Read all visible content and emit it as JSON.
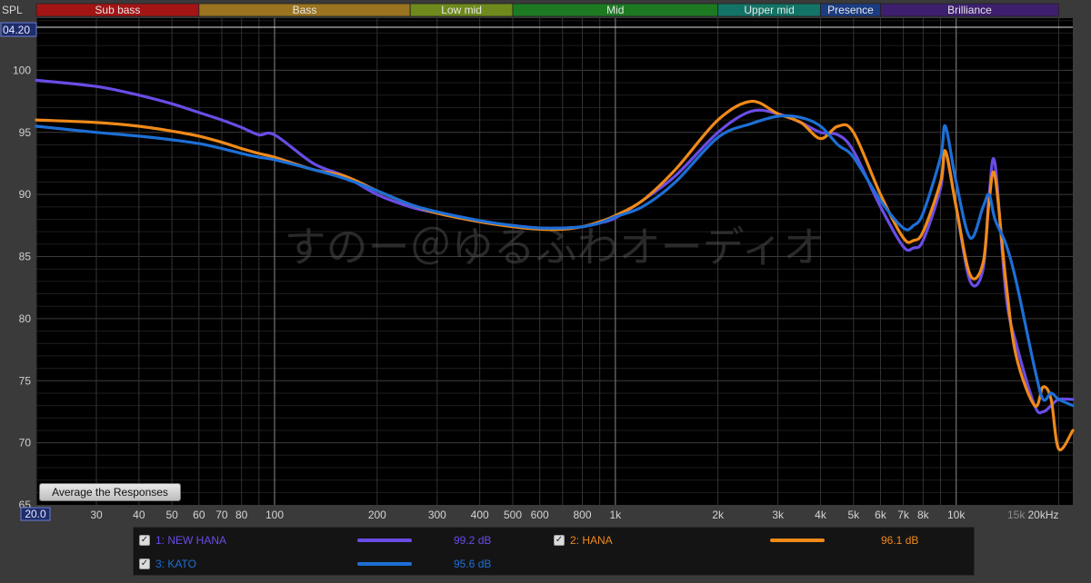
{
  "chart_data": {
    "type": "line",
    "ylabel": "SPL",
    "xlabel": "",
    "cursor_value": "04.20",
    "x_scale": "log",
    "xlim": [
      20,
      22000
    ],
    "ylim": [
      65,
      104.2
    ],
    "y_ticks": [
      65,
      70,
      75,
      80,
      85,
      90,
      95,
      100
    ],
    "y_tick_labels": [
      "65",
      "70",
      "75",
      "80",
      "85",
      "90",
      "95",
      "100"
    ],
    "x_ticks": [
      20,
      30,
      40,
      50,
      60,
      70,
      80,
      100,
      200,
      300,
      400,
      500,
      600,
      800,
      1000,
      2000,
      3000,
      4000,
      5000,
      6000,
      7000,
      8000,
      10000,
      15000,
      20000
    ],
    "x_tick_labels": [
      "20.0",
      "30",
      "40",
      "50",
      "60",
      "70",
      "80",
      "100",
      "200",
      "300",
      "400",
      "500",
      "600",
      "800",
      "1k",
      "2k",
      "3k",
      "4k",
      "5k",
      "6k",
      "7k",
      "8k",
      "10k",
      "15k",
      "20kHz"
    ],
    "grid": true,
    "bands": [
      {
        "label": "Sub bass",
        "from": 20,
        "to": 60,
        "color": "#a31414"
      },
      {
        "label": "Bass",
        "from": 60,
        "to": 250,
        "color": "#9a7420"
      },
      {
        "label": "Low mid",
        "from": 250,
        "to": 500,
        "color": "#6f8a1c"
      },
      {
        "label": "Mid",
        "from": 500,
        "to": 2000,
        "color": "#1d7a22"
      },
      {
        "label": "Upper mid",
        "from": 2000,
        "to": 4000,
        "color": "#137366"
      },
      {
        "label": "Presence",
        "from": 4000,
        "to": 6000,
        "color": "#1b3c82"
      },
      {
        "label": "Brilliance",
        "from": 6000,
        "to": 20000,
        "color": "#3d1f6e"
      }
    ],
    "watermark": "すのー＠ゆるふわオーディオ",
    "series": [
      {
        "name": "1: NEW HANA",
        "color": "#6a4ce6",
        "avg": "99.2 dB",
        "x": [
          20,
          30,
          40,
          50,
          60,
          70,
          80,
          90,
          100,
          130,
          160,
          200,
          250,
          300,
          400,
          500,
          600,
          700,
          800,
          900,
          1000,
          1200,
          1500,
          2000,
          2500,
          3000,
          3500,
          4000,
          4500,
          5000,
          6000,
          7000,
          7500,
          8000,
          9000,
          9300,
          10000,
          11000,
          12000,
          12500,
          13000,
          14000,
          15000,
          17000,
          18000,
          19000,
          20000,
          22000
        ],
        "y": [
          99.2,
          98.7,
          98.0,
          97.3,
          96.6,
          96.0,
          95.4,
          94.8,
          94.8,
          92.5,
          91.5,
          90.0,
          89.0,
          88.5,
          87.8,
          87.5,
          87.3,
          87.3,
          87.4,
          87.7,
          88.1,
          89.5,
          91.5,
          95.0,
          96.7,
          96.5,
          95.8,
          95.0,
          94.8,
          93.5,
          89.0,
          85.8,
          85.7,
          86.3,
          90.5,
          93.5,
          89.0,
          83.0,
          84.0,
          90.0,
          92.5,
          82.0,
          78.0,
          73.0,
          72.5,
          73.0,
          73.5,
          73.5
        ]
      },
      {
        "name": "2: HANA",
        "color": "#f08a19",
        "avg": "96.1 dB",
        "x": [
          20,
          30,
          40,
          50,
          60,
          70,
          80,
          90,
          100,
          130,
          160,
          200,
          250,
          300,
          400,
          500,
          600,
          700,
          800,
          900,
          1000,
          1200,
          1500,
          2000,
          2500,
          3000,
          3500,
          4000,
          4500,
          5000,
          6000,
          7000,
          7500,
          8000,
          9000,
          9300,
          10000,
          11000,
          12000,
          12500,
          13000,
          14000,
          15000,
          17000,
          18000,
          19000,
          20000,
          22000
        ],
        "y": [
          96.0,
          95.8,
          95.5,
          95.1,
          94.7,
          94.2,
          93.7,
          93.3,
          93.0,
          92.0,
          91.5,
          90.3,
          89.2,
          88.5,
          87.8,
          87.4,
          87.2,
          87.2,
          87.4,
          87.8,
          88.3,
          89.5,
          92.0,
          96.0,
          97.5,
          96.5,
          95.8,
          94.5,
          95.5,
          95.0,
          90.0,
          86.5,
          86.3,
          87.0,
          91.0,
          93.5,
          89.0,
          83.5,
          84.5,
          89.5,
          91.5,
          83.0,
          77.0,
          73.0,
          74.5,
          73.5,
          69.5,
          71.0
        ]
      },
      {
        "name": "3: KATO",
        "color": "#1d6fd6",
        "avg": "95.6 dB",
        "x": [
          20,
          30,
          40,
          50,
          60,
          70,
          80,
          90,
          100,
          130,
          160,
          200,
          250,
          300,
          400,
          500,
          600,
          700,
          800,
          900,
          1000,
          1200,
          1500,
          2000,
          2500,
          3000,
          3500,
          4000,
          4500,
          5000,
          6000,
          7000,
          7500,
          8000,
          9000,
          9300,
          10000,
          11000,
          12000,
          12500,
          13000,
          14000,
          15000,
          17000,
          18000,
          19000,
          20000,
          22000
        ],
        "y": [
          95.5,
          95.0,
          94.7,
          94.4,
          94.1,
          93.7,
          93.3,
          93.0,
          92.8,
          92.0,
          91.3,
          90.3,
          89.2,
          88.6,
          87.9,
          87.5,
          87.3,
          87.3,
          87.4,
          87.7,
          88.2,
          89.0,
          91.0,
          94.6,
          95.7,
          96.3,
          96.2,
          95.5,
          94.0,
          93.0,
          89.5,
          87.3,
          87.5,
          88.5,
          93.0,
          95.5,
          91.0,
          86.5,
          89.0,
          90.0,
          88.0,
          86.0,
          83.0,
          76.0,
          73.5,
          74.0,
          73.5,
          73.0
        ]
      }
    ]
  },
  "ui": {
    "average_button": "Average the Responses"
  }
}
